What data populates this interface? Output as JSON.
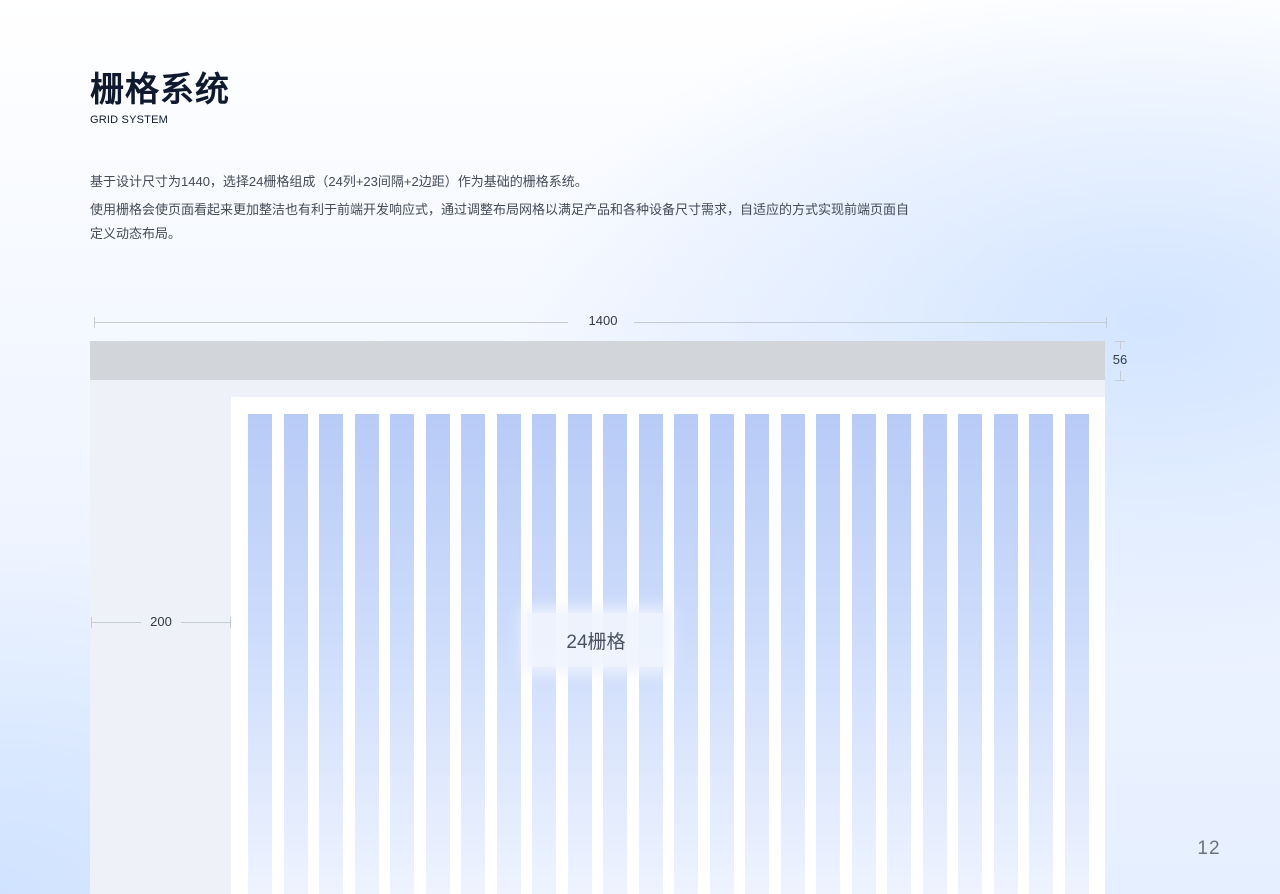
{
  "header": {
    "title": "栅格系统",
    "subtitle": "GRID SYSTEM"
  },
  "description": {
    "line1": "基于设计尺寸为1440，选择24栅格组成（24列+23间隔+2边距）作为基础的栅格系统。",
    "line2": "使用栅格会使页面看起来更加整洁也有利于前端开发响应式，通过调整布局网格以满足产品和各种设备尺寸需求，自适应的方式实现前端页面自定义动态布局。"
  },
  "diagram": {
    "width_label": "1400",
    "header_height_label": "56",
    "sidebar_width_label": "200",
    "grid_label": "24栅格",
    "column_count": 24,
    "colors": {
      "header_bar": "#d2d6da",
      "sidebar": "#eef1f7",
      "column_top": "#b8cbf7",
      "column_bottom": "#eef3fe"
    }
  },
  "page_number": "12"
}
